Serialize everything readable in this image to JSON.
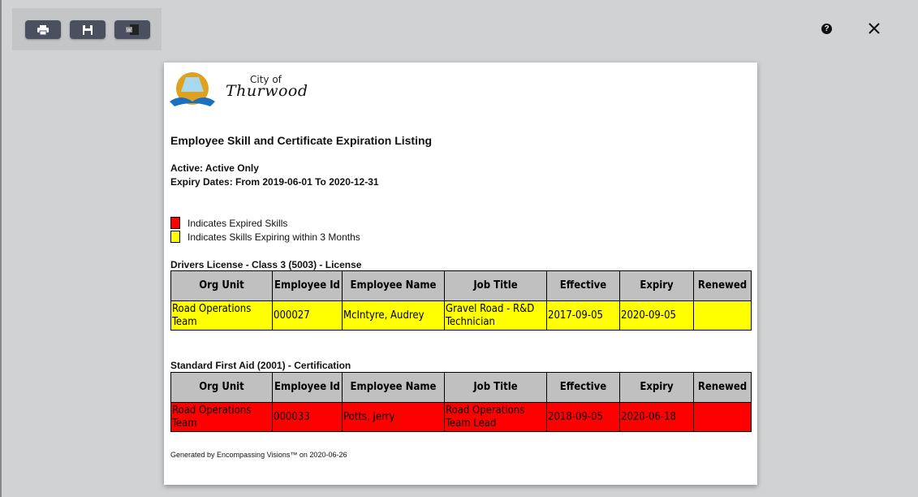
{
  "toolbar": {
    "buttons": [
      {
        "name": "print-button",
        "icon": "printer-icon"
      },
      {
        "name": "save-button",
        "icon": "floppy-disk-icon"
      },
      {
        "name": "export-word-button",
        "icon": "word-document-icon"
      }
    ]
  },
  "header": {
    "help_icon": "?",
    "close_icon": "close-icon"
  },
  "report": {
    "logo": {
      "line1": "City of",
      "line2": "Thurwood"
    },
    "title": "Employee Skill and Certificate Expiration Listing",
    "filters": [
      "Active: Active Only",
      "Expiry Dates: From 2019-06-01 To 2020-12-31"
    ],
    "legend": [
      {
        "color": "#ff0000",
        "label": "Indicates Expired Skills"
      },
      {
        "color": "#ffff00",
        "label": "Indicates Skills Expiring within 3 Months"
      }
    ],
    "columns": [
      "Org Unit",
      "Employee Id",
      "Employee Name",
      "Job Title",
      "Effective",
      "Expiry",
      "Renewed"
    ],
    "sections": [
      {
        "title": "Drivers License - Class 3 (5003) - License",
        "status": "expiring",
        "color": "#ffff00",
        "rows": [
          [
            "Road Operations Team",
            "000027",
            "McIntyre, Audrey",
            "Gravel Road - R&D Technician",
            "2017-09-05",
            "2020-09-05",
            ""
          ]
        ]
      },
      {
        "title": "Standard First Aid (2001) - Certification",
        "status": "expired",
        "color": "#ff0000",
        "rows": [
          [
            "Road Operations Team",
            "000033",
            "Potts, Jerry",
            "Road Operations Team Lead",
            "2018-09-05",
            "2020-06-18",
            ""
          ]
        ]
      }
    ],
    "footer": "Generated by Encompassing Visions™ on 2020-06-26"
  }
}
